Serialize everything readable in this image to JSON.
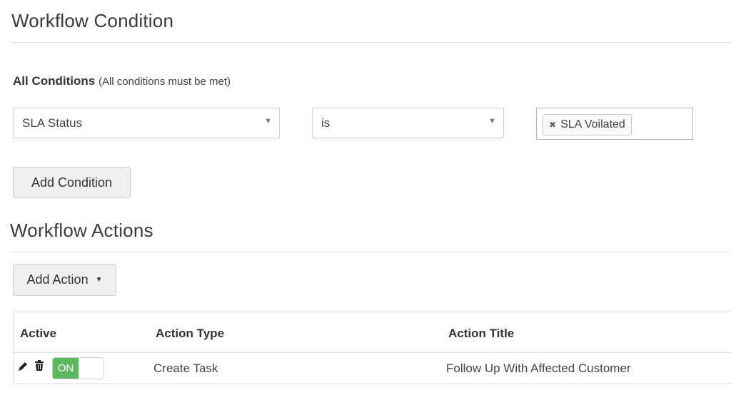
{
  "condition_section": {
    "title": "Workflow Condition",
    "heading_bold": "All Conditions",
    "heading_sub": "(All conditions must be met)",
    "field_select": {
      "value": "SLA Status"
    },
    "operator_select": {
      "value": "is"
    },
    "value_tags": [
      {
        "label": "SLA Voilated"
      }
    ],
    "add_condition_label": "Add Condition"
  },
  "actions_section": {
    "title": "Workflow Actions",
    "add_action_label": "Add Action",
    "table": {
      "columns": [
        "Active",
        "Action Type",
        "Action Title"
      ],
      "rows": [
        {
          "active": true,
          "toggle_label": "ON",
          "action_type": "Create Task",
          "action_title": "Follow Up With Affected Customer"
        }
      ]
    }
  },
  "colors": {
    "toggle_on": "#5cb85c",
    "button_bg": "#f0f0f0",
    "border": "#cfcfcf"
  },
  "icons": {
    "edit": "pencil-icon",
    "delete": "trash-icon",
    "dropdown": "caret-down-icon",
    "remove_tag": "close-icon"
  }
}
